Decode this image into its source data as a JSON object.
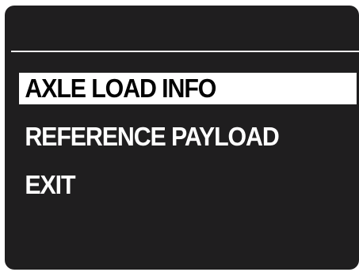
{
  "menu": {
    "items": [
      {
        "label": "AXLE LOAD INFO",
        "selected": true
      },
      {
        "label": "REFERENCE PAYLOAD",
        "selected": false
      },
      {
        "label": "EXIT",
        "selected": false
      }
    ]
  },
  "colors": {
    "screen_background": "#1f1e1f",
    "text": "#ffffff",
    "highlight_background": "#ffffff",
    "highlight_text": "#000000",
    "divider": "#f2f2f2"
  }
}
